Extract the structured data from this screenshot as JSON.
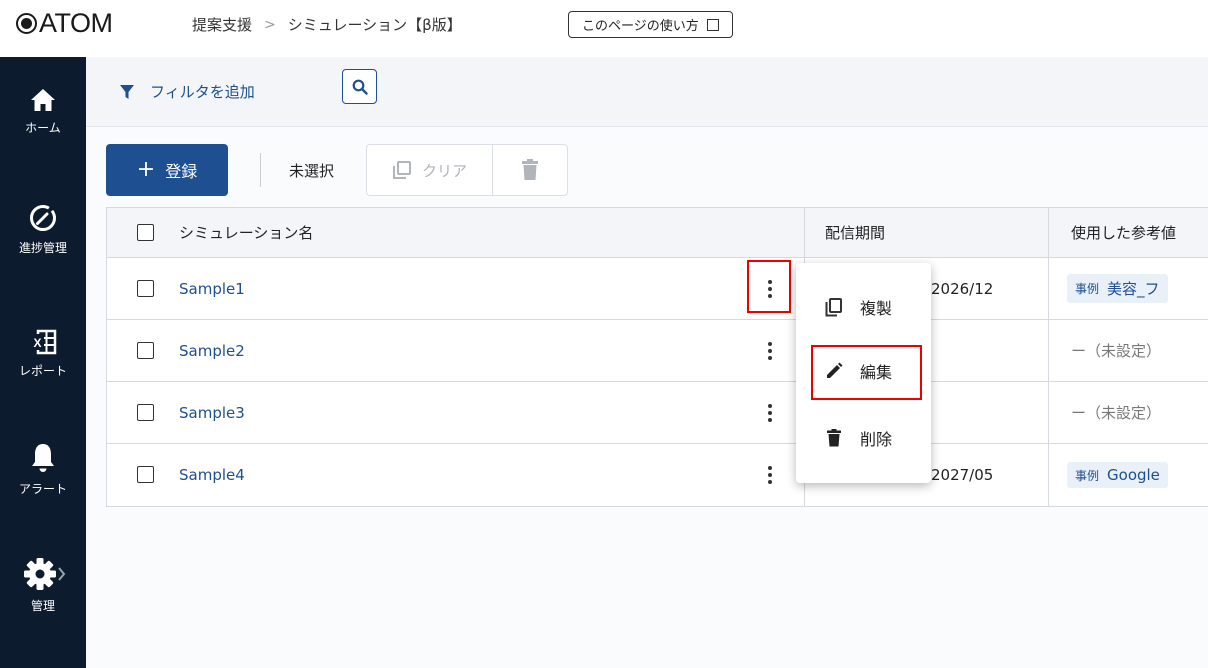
{
  "app": {
    "logo_text": "ATOM",
    "breadcrumb": [
      "提案支援",
      "シミュレーション【β版】"
    ],
    "breadcrumb_sep": ">",
    "help_link": "このページの使い方"
  },
  "sidebar": {
    "items": [
      {
        "label": "ホーム",
        "icon": "home-icon"
      },
      {
        "label": "進捗管理",
        "icon": "progress-icon"
      },
      {
        "label": "レポート",
        "icon": "excel-report-icon"
      },
      {
        "label": "アラート",
        "icon": "bell-icon"
      },
      {
        "label": "管理",
        "icon": "gear-icon"
      }
    ]
  },
  "filter": {
    "add_label": "フィルタを追加"
  },
  "toolbar": {
    "register_label": "登録",
    "selection_status": "未選択",
    "clear_label": "クリア"
  },
  "table": {
    "headers": {
      "name": "シミュレーション名",
      "period": "配信期間",
      "reference": "使用した参考値"
    },
    "rows": [
      {
        "name": "Sample1",
        "period": "2026/12",
        "ref_type": "事例",
        "ref_value": "美容_フ",
        "unset": ""
      },
      {
        "name": "Sample2",
        "period": "",
        "ref_type": "",
        "ref_value": "",
        "unset": "ー（未設定）"
      },
      {
        "name": "Sample3",
        "period": "",
        "ref_type": "",
        "ref_value": "",
        "unset": "ー（未設定）"
      },
      {
        "name": "Sample4",
        "period": "2027/05",
        "ref_type": "事例",
        "ref_value": "Google",
        "unset": ""
      }
    ]
  },
  "context_menu": {
    "items": [
      {
        "label": "複製",
        "icon": "copy-icon"
      },
      {
        "label": "編集",
        "icon": "pencil-icon"
      },
      {
        "label": "削除",
        "icon": "trash-icon"
      }
    ]
  },
  "colors": {
    "primary": "#1d4f91",
    "sidebar_bg": "#0d1b2e",
    "highlight": "#ee0000"
  }
}
